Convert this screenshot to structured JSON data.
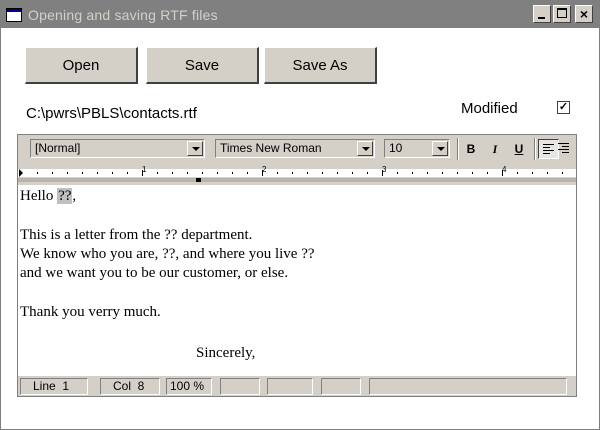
{
  "window": {
    "title": "Opening and saving RTF files",
    "controls": {
      "minimize": "_",
      "maximize": "□",
      "close": "×"
    }
  },
  "buttons": {
    "open": "Open",
    "save": "Save",
    "save_as": "Save As"
  },
  "file": {
    "path": "C:\\pwrs\\PBLS\\contacts.rtf"
  },
  "modified": {
    "label": "Modified",
    "checked": "✓"
  },
  "toolbar": {
    "style": "[Normal]",
    "font": "Times New Roman",
    "size": "10",
    "bold": "B",
    "italic": "I",
    "underline": "U"
  },
  "ruler": {
    "marks": [
      "1",
      "2",
      "3",
      "4"
    ]
  },
  "document": {
    "lines": [
      {
        "before": "Hello ",
        "field": "??",
        "after": ","
      },
      {
        "text": "This is a letter from the ?? department."
      },
      {
        "text": "We know who you are, ??, and where you live ??"
      },
      {
        "text": "and we want you to be our customer, or else."
      },
      {
        "text": "Thank you verry much."
      },
      {
        "text": "Sincerely,"
      }
    ]
  },
  "status": {
    "line": "Line  1",
    "col": "Col  8",
    "zoom": "100 %"
  }
}
